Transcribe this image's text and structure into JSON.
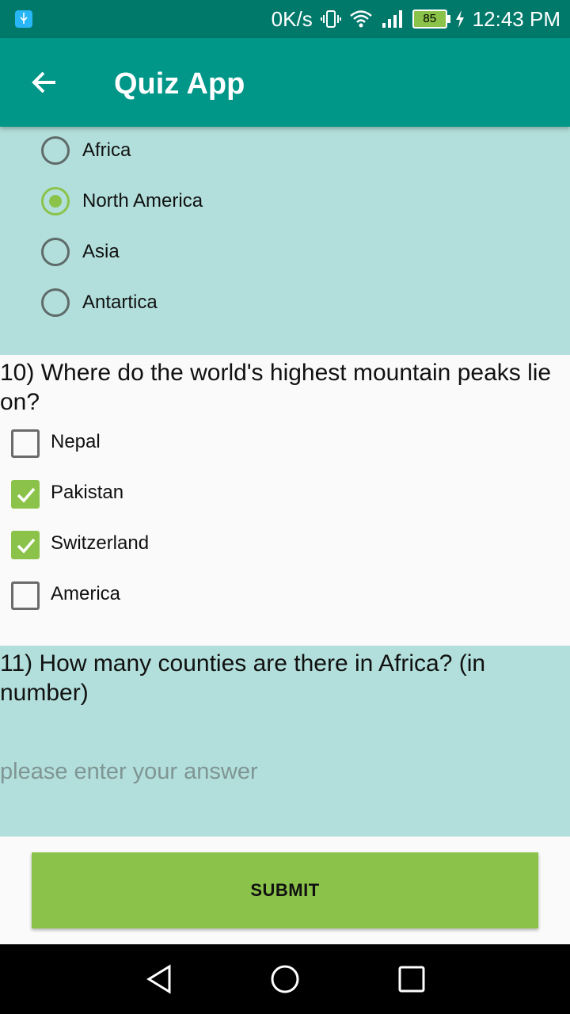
{
  "status": {
    "net_speed": "0K/s",
    "battery": "85",
    "time": "12:43 PM"
  },
  "appbar": {
    "title": "Quiz App"
  },
  "q9": {
    "options": [
      "Africa",
      "North America",
      "Asia",
      "Antartica"
    ],
    "selected": "North America"
  },
  "q10": {
    "question": "10) Where do the world's highest mountain peaks lie on?",
    "options": [
      "Nepal",
      "Pakistan",
      "Switzerland",
      "America"
    ],
    "checked": [
      "Pakistan",
      "Switzerland"
    ]
  },
  "q11": {
    "question": "11) How many counties are there in Africa? (in number)",
    "placeholder": "please enter your answer"
  },
  "submit_label": "SUBMIT",
  "colors": {
    "status_bar": "#00796b",
    "app_bar": "#009688",
    "accent": "#8bc34a",
    "section_bg": "#b2dfdb"
  }
}
